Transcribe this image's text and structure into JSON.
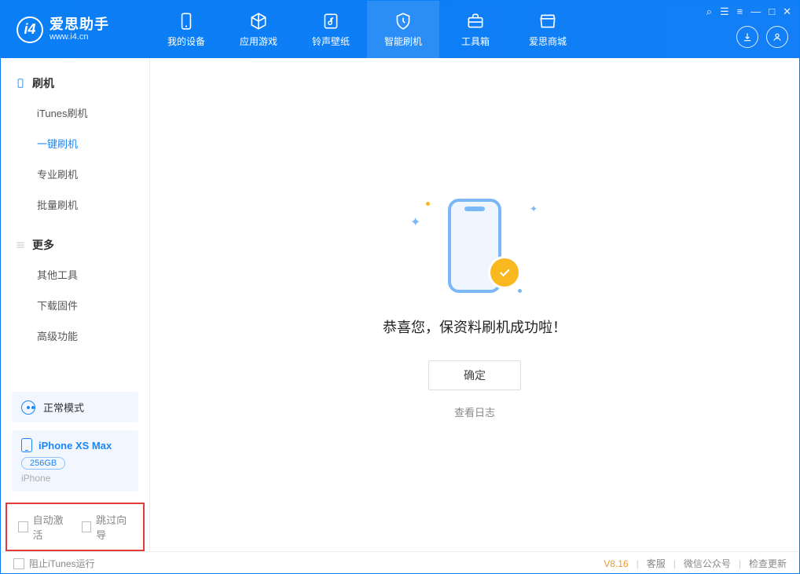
{
  "app": {
    "title": "爱思助手",
    "url": "www.i4.cn"
  },
  "nav": {
    "tabs": [
      {
        "label": "我的设备",
        "icon": "device"
      },
      {
        "label": "应用游戏",
        "icon": "cube"
      },
      {
        "label": "铃声壁纸",
        "icon": "music"
      },
      {
        "label": "智能刷机",
        "icon": "shield"
      },
      {
        "label": "工具箱",
        "icon": "toolbox"
      },
      {
        "label": "爱思商城",
        "icon": "shop"
      }
    ],
    "active_index": 3
  },
  "sidebar": {
    "sections": [
      {
        "title": "刷机",
        "items": [
          "iTunes刷机",
          "一键刷机",
          "专业刷机",
          "批量刷机"
        ],
        "active_index": 1
      },
      {
        "title": "更多",
        "items": [
          "其他工具",
          "下载固件",
          "高级功能"
        ]
      }
    ],
    "mode": {
      "label": "正常模式"
    },
    "device": {
      "name": "iPhone XS Max",
      "capacity": "256GB",
      "type": "iPhone"
    },
    "checkboxes": {
      "auto_activate": "自动激活",
      "skip_guide": "跳过向导"
    }
  },
  "main": {
    "success_text": "恭喜您，保资料刷机成功啦！",
    "ok_button": "确定",
    "log_link": "查看日志"
  },
  "footer": {
    "block_itunes": "阻止iTunes运行",
    "version": "V8.16",
    "links": [
      "客服",
      "微信公众号",
      "检查更新"
    ]
  }
}
